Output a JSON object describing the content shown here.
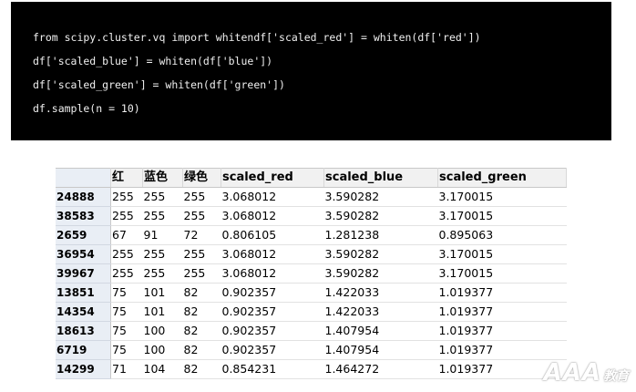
{
  "code": {
    "lines": [
      "from scipy.cluster.vq import whitendf['scaled_red'] = whiten(df['red'])",
      "df['scaled_blue'] = whiten(df['blue'])",
      "df['scaled_green'] = whiten(df['green'])",
      "df.sample(n = 10)"
    ]
  },
  "table": {
    "columns": [
      "",
      "红",
      "蓝色",
      "绿色",
      "scaled_red",
      "scaled_blue",
      "scaled_green"
    ],
    "rows": [
      {
        "index": "24888",
        "cells": [
          "255",
          "255",
          "255",
          "3.068012",
          "3.590282",
          "3.170015"
        ]
      },
      {
        "index": "38583",
        "cells": [
          "255",
          "255",
          "255",
          "3.068012",
          "3.590282",
          "3.170015"
        ]
      },
      {
        "index": "2659",
        "cells": [
          "67",
          "91",
          "72",
          "0.806105",
          "1.281238",
          "0.895063"
        ]
      },
      {
        "index": "36954",
        "cells": [
          "255",
          "255",
          "255",
          "3.068012",
          "3.590282",
          "3.170015"
        ]
      },
      {
        "index": "39967",
        "cells": [
          "255",
          "255",
          "255",
          "3.068012",
          "3.590282",
          "3.170015"
        ]
      },
      {
        "index": "13851",
        "cells": [
          "75",
          "101",
          "82",
          "0.902357",
          "1.422033",
          "1.019377"
        ]
      },
      {
        "index": "14354",
        "cells": [
          "75",
          "101",
          "82",
          "0.902357",
          "1.422033",
          "1.019377"
        ]
      },
      {
        "index": "18613",
        "cells": [
          "75",
          "100",
          "82",
          "0.902357",
          "1.407954",
          "1.019377"
        ]
      },
      {
        "index": "6719",
        "cells": [
          "75",
          "100",
          "82",
          "0.902357",
          "1.407954",
          "1.019377"
        ]
      },
      {
        "index": "14299",
        "cells": [
          "71",
          "104",
          "82",
          "0.854231",
          "1.464272",
          "1.019377"
        ]
      }
    ]
  },
  "watermark": {
    "main": "AAA",
    "sub": "教育"
  }
}
